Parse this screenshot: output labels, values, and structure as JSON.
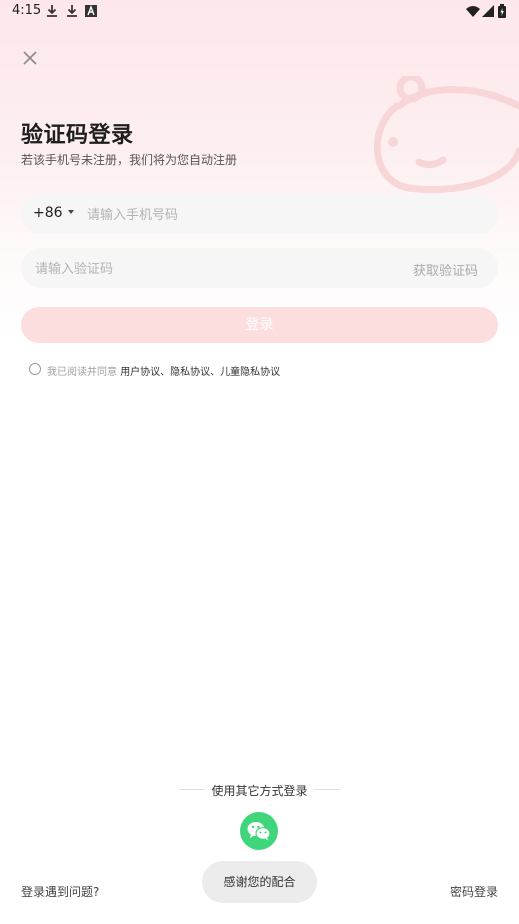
{
  "status_bar": {
    "time": "4:15",
    "left_icons": [
      "download-icon",
      "download-icon",
      "font-a-icon"
    ],
    "right_icons": [
      "wifi-icon",
      "cell-signal-icon",
      "battery-icon"
    ]
  },
  "header": {
    "title": "验证码登录",
    "subtitle": "若该手机号未注册，我们将为您自动注册"
  },
  "phone": {
    "country_code": "+86",
    "placeholder": "请输入手机号码"
  },
  "code": {
    "placeholder": "请输入验证码",
    "get_code_label": "获取验证码"
  },
  "login_button": "登录",
  "agreement": {
    "prefix": "我已阅读并同意",
    "links": "用户协议、隐私协议、儿童隐私协议"
  },
  "other_methods": {
    "label": "使用其它方式登录",
    "wechat_icon": "wechat-icon"
  },
  "footer": {
    "trouble": "登录遇到问题?",
    "password_login": "密码登录"
  },
  "toast": "感谢您的配合",
  "colors": {
    "accent_pink": "#fcdede",
    "wechat_green": "#3fd67b"
  }
}
